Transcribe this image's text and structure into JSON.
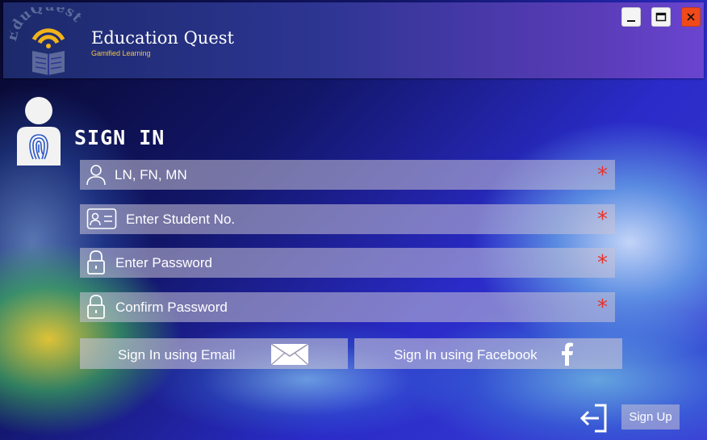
{
  "app": {
    "logo_text": "EduQuest",
    "title": "Education Quest",
    "subtitle": "Gamified Learning"
  },
  "window_controls": [
    "minimize",
    "maximize",
    "close"
  ],
  "form": {
    "heading": "SIGN IN",
    "fields": [
      {
        "icon": "user-icon",
        "placeholder": "LN, FN, MN",
        "required_mark": "*"
      },
      {
        "icon": "id-card-icon",
        "placeholder": "Enter Student No.",
        "required_mark": "*"
      },
      {
        "icon": "lock-icon",
        "placeholder": "Enter Password",
        "required_mark": "*"
      },
      {
        "icon": "lock-icon",
        "placeholder": "Confirm Password",
        "required_mark": "*"
      }
    ],
    "email_button": "Sign In using Email",
    "facebook_button": "Sign In using Facebook",
    "signup_button": "Sign Up"
  },
  "colors": {
    "required": "#e8322a",
    "subtitle": "#f3c545",
    "close": "#f04a1a"
  }
}
